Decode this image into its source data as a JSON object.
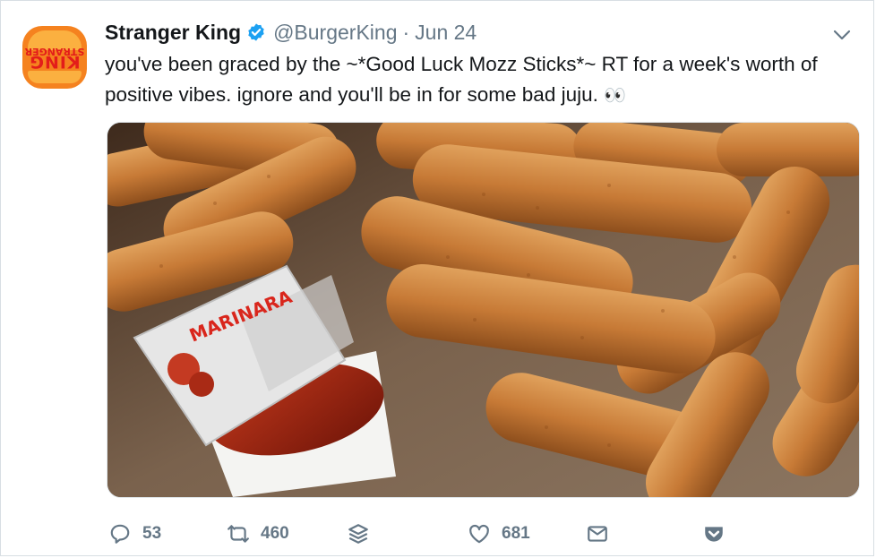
{
  "tweet": {
    "display_name": "Stranger King",
    "handle": "@BurgerKing",
    "separator": "·",
    "date": "Jun 24",
    "text": "you've been graced by the ~*Good Luck Mozz Sticks*~ RT for a week's worth of positive vibes. ignore and you'll be in for some bad juju.",
    "emoji": "👀"
  },
  "avatar": {
    "logo_line1": "KING",
    "logo_line2": "STRANGER",
    "colors": {
      "background": "#f5821f",
      "bun": "#fbb040",
      "text": "#e31d1a"
    }
  },
  "media": {
    "sauce_label": "MARINARA"
  },
  "actions": {
    "reply_count": "53",
    "retweet_count": "460",
    "like_count": "681"
  },
  "icons": {
    "verified": "verified-badge-icon",
    "caret": "chevron-down-icon",
    "reply": "reply-icon",
    "retweet": "retweet-icon",
    "stack": "layers-icon",
    "like": "heart-icon",
    "message": "envelope-icon",
    "pocket": "pocket-icon"
  },
  "colors": {
    "text": "#14171a",
    "muted": "#657786",
    "verified": "#1da1f2",
    "border": "#d8dee3"
  }
}
